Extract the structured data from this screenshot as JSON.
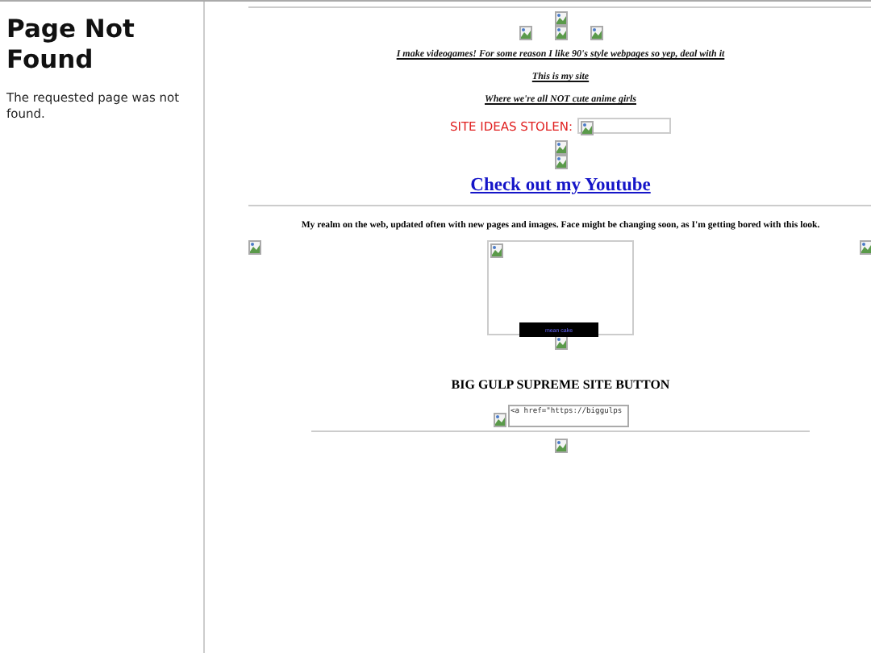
{
  "sidebar": {
    "title": "Page Not Found",
    "message": "The requested page was not found."
  },
  "main": {
    "taglines": [
      "I make videogames! For some reason I like 90's style webpages so yep, deal with it",
      "This is my site",
      "Where we're all NOT cute anime girls"
    ],
    "stolen_label": "SITE IDEAS STOLEN:",
    "youtube_link": "Check out my Youtube",
    "intro": "My realm on the web, updated often with new pages and images. Face might be changing soon, as I'm getting bored with this look.",
    "player_caption": "mean cake",
    "button_heading": "BIG GULP SUPREME SITE BUTTON",
    "code_box": "<a href=\"https://biggulps"
  }
}
